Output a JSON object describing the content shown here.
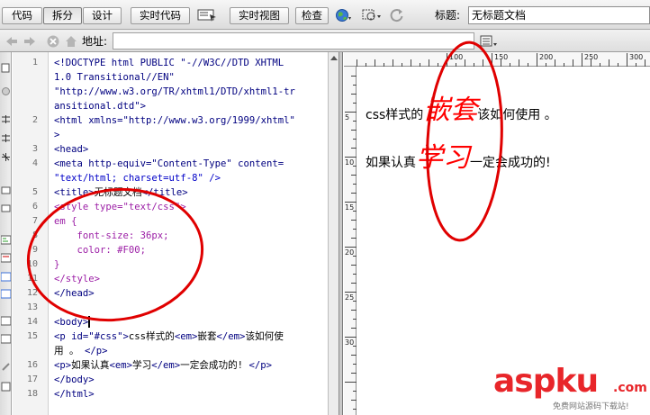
{
  "toolbar": {
    "code_label": "代码",
    "split_label": "拆分",
    "design_label": "设计",
    "live_code_label": "实时代码",
    "live_view_label": "实时视图",
    "inspect_label": "检查",
    "title_label": "标题:",
    "title_value": "无标题文档"
  },
  "address_bar": {
    "label": "地址:",
    "value": ""
  },
  "code": {
    "line_numbers": [
      "1",
      "2",
      "3",
      "4",
      "5",
      "6",
      "7",
      "8",
      "9",
      "10",
      "11",
      "12",
      "13",
      "14",
      "15",
      "16",
      "17",
      "18"
    ],
    "l1a": "<!DOCTYPE html PUBLIC \"-//W3C//DTD XHTML",
    "l1b": "1.0 Transitional//EN\"",
    "l1c": "\"http://www.w3.org/TR/xhtml1/DTD/xhtml1-tr",
    "l1d": "ansitional.dtd\">",
    "l2a": "<html xmlns=\"http://www.w3.org/1999/xhtml\"",
    "l2b": ">",
    "l3": "<head>",
    "l4a": "<meta http-equiv=\"Content-Type\" content=",
    "l4b": "\"text/html; charset=utf-8\" />",
    "l5_open": "<title>",
    "l5_text": "无标题文档",
    "l5_close": "</title>",
    "l6": "<style type=\"text/css\">",
    "l7": "em {",
    "l8": "    font-size: 36px;",
    "l9": "    color: #F00;",
    "l10": "}",
    "l11": "</style>",
    "l12": "</head>",
    "l13": "",
    "l14": "<body>",
    "l15a_open": "<p id=\"#css\">",
    "l15a_text1": "css样式的",
    "l15a_em": "<em>",
    "l15a_text2": "嵌套",
    "l15a_emc": "</em>",
    "l15a_text3": "该如何使",
    "l15b_text": "用 。 ",
    "l15b_close": "</p>",
    "l16_open": "<p>",
    "l16_text1": "如果认真",
    "l16_em": "<em>",
    "l16_text2": "学习",
    "l16_emc": "</em>",
    "l16_text3": "一定会成功的! ",
    "l16_close": "</p>",
    "l17": "</body>",
    "l18": "</html>"
  },
  "design": {
    "ruler_labels": [
      "100",
      "150",
      "200",
      "250",
      "300"
    ],
    "vruler_labels": [
      "5",
      "10",
      "15",
      "20",
      "25",
      "30"
    ],
    "p1_before": "css样式的",
    "p1_em": "嵌套",
    "p1_after": "该如何使用 。",
    "p2_before": "如果认真",
    "p2_em": "学习",
    "p2_after": "一定会成功的!"
  },
  "watermark": {
    "logo_asp": "asp",
    "logo_ku": "ku",
    "logo_com": ".com",
    "subtitle": "免费网站源码下载站!"
  },
  "colors": {
    "accent_red": "#ff0000",
    "annotation_red": "#e00000",
    "tag_blue": "#000080",
    "css_purple": "#9c1fa6"
  }
}
